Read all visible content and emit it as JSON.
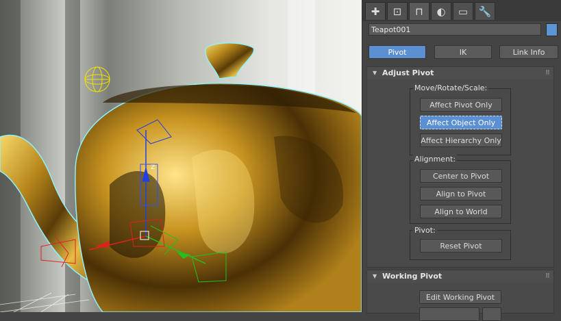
{
  "panel": {
    "tabs": [
      {
        "icon": "create-icon",
        "glyph": "✚"
      },
      {
        "icon": "modify-icon",
        "glyph": "⊡"
      },
      {
        "icon": "hierarchy-icon",
        "glyph": "⊓"
      },
      {
        "icon": "motion-icon",
        "glyph": "◐"
      },
      {
        "icon": "display-icon",
        "glyph": "▭"
      },
      {
        "icon": "utilities-icon",
        "glyph": "🔧"
      }
    ],
    "object_name": "Teapot001",
    "object_color": "#5b95d6",
    "mode_buttons": {
      "pivot": "Pivot",
      "ik": "IK",
      "link_info": "Link Info"
    },
    "selected_mode": "Pivot",
    "adjust_pivot": {
      "title": "Adjust Pivot",
      "move_group": "Move/Rotate/Scale:",
      "affect_pivot_only": "Affect Pivot Only",
      "affect_object_only": "Affect Object Only",
      "affect_hierarchy_only": "Affect Hierarchy Only",
      "selected": "Affect Object Only",
      "alignment_group": "Alignment:",
      "center_to_pivot": "Center to Pivot",
      "align_to_pivot": "Align to Pivot",
      "align_to_world": "Align to World",
      "pivot_group": "Pivot:",
      "reset_pivot": "Reset Pivot"
    },
    "working_pivot": {
      "title": "Working Pivot",
      "edit_working_pivot": "Edit Working Pivot"
    }
  },
  "viewport": {
    "gizmo_axis_label": "Z",
    "colors": {
      "gold": "#c9a12a",
      "selection": "#8ef0ff",
      "x_axis": "#e02020",
      "y_axis": "#20c020",
      "z_axis": "#2040e0"
    }
  }
}
